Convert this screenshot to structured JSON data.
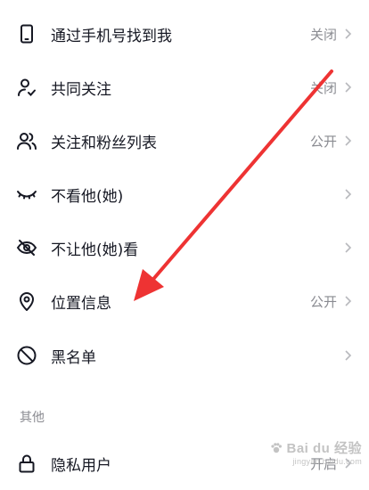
{
  "settings": {
    "items": [
      {
        "label": "通过手机号找到我",
        "value": "关闭",
        "icon": "phone-icon"
      },
      {
        "label": "共同关注",
        "value": "关闭",
        "icon": "user-check-icon"
      },
      {
        "label": "关注和粉丝列表",
        "value": "公开",
        "icon": "users-icon"
      },
      {
        "label": "不看他(她)",
        "value": "",
        "icon": "closed-eye-icon"
      },
      {
        "label": "不让他(她)看",
        "value": "",
        "icon": "eye-slash-icon"
      },
      {
        "label": "位置信息",
        "value": "公开",
        "icon": "location-pin-icon"
      },
      {
        "label": "黑名单",
        "value": "",
        "icon": "block-icon"
      }
    ],
    "section_other": "其他",
    "other_items": [
      {
        "label": "隐私用户",
        "value": "开启",
        "icon": "lock-icon"
      }
    ]
  },
  "watermark": {
    "brand": "Bai du 经验",
    "url": "jingyan.baidu.com"
  },
  "colors": {
    "text": "#161823",
    "secondary": "#8a8b91",
    "arrow": "#ee3333"
  }
}
